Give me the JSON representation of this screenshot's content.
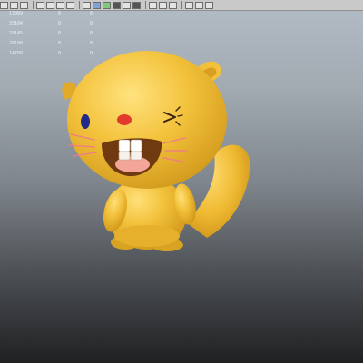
{
  "toolbar": {
    "icons": [
      "select-tool-icon",
      "lasso-tool-icon",
      "paint-tool-icon",
      "move-tool-icon",
      "rotate-tool-icon",
      "scale-tool-icon",
      "camera-icon",
      "grid-icon",
      "wireframe-icon",
      "smooth-shade-icon",
      "textured-icon",
      "lighting-icon",
      "shadow-icon",
      "xray-icon",
      "isolate-icon",
      "resolution-gate-icon",
      "film-gate-icon",
      "render-icon"
    ]
  },
  "hud": {
    "rows": [
      [
        "13089",
        "0",
        "0"
      ],
      [
        "33104",
        "0",
        "0"
      ],
      [
        "29145",
        "0",
        "0"
      ],
      [
        "26108",
        "0",
        "0"
      ],
      [
        "14709",
        "0",
        "0"
      ]
    ]
  },
  "colors": {
    "body": "#f2c13b",
    "body_shadow": "#d49b1f",
    "mouth": "#6f3a10",
    "tongue": "#f3a59a",
    "teeth": "#ffffff",
    "eye": "#1f2a8a",
    "nose": "#e23b2c",
    "whisker": "#f07a8a",
    "wink": "#3a2210"
  }
}
